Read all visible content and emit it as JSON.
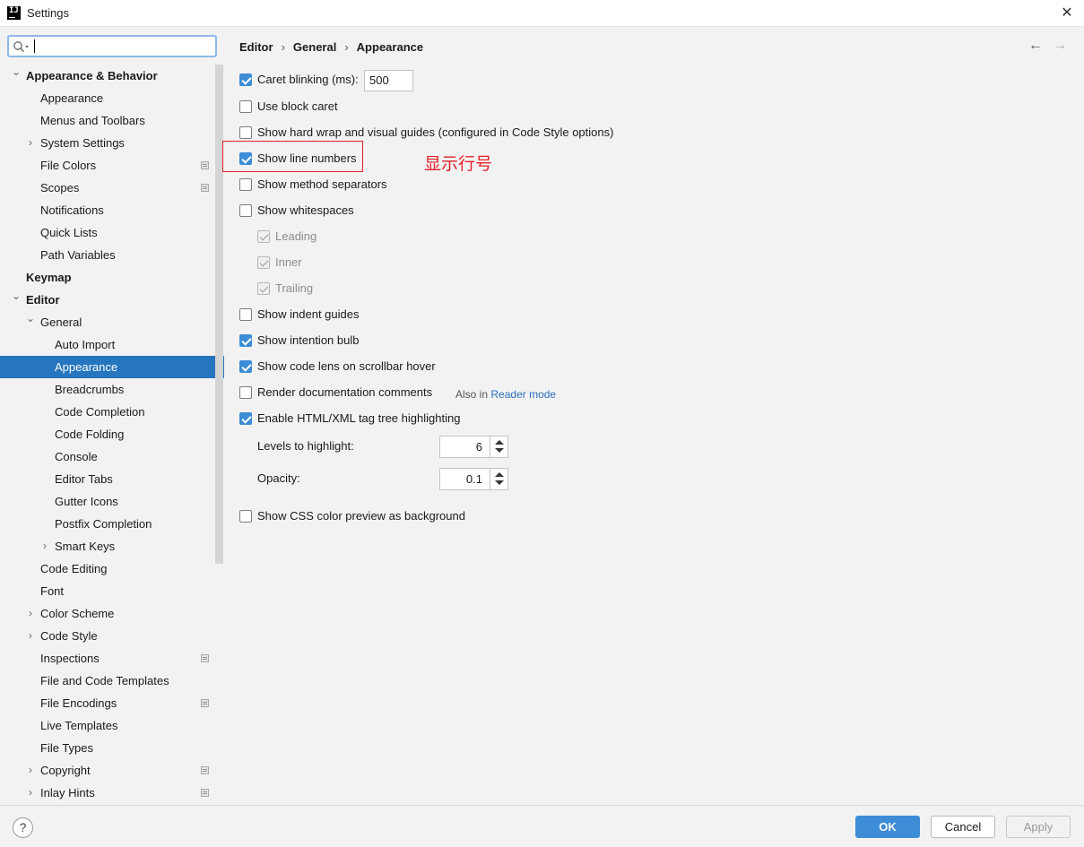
{
  "window": {
    "title": "Settings"
  },
  "sidebar": {
    "search_value": "",
    "items": [
      {
        "label": "Appearance & Behavior",
        "level": 0,
        "chev": "down",
        "bold": true,
        "proj": false
      },
      {
        "label": "Appearance",
        "level": 1,
        "chev": "",
        "bold": false,
        "proj": false
      },
      {
        "label": "Menus and Toolbars",
        "level": 1,
        "chev": "",
        "bold": false,
        "proj": false
      },
      {
        "label": "System Settings",
        "level": 1,
        "chev": "right",
        "bold": false,
        "proj": false
      },
      {
        "label": "File Colors",
        "level": 1,
        "chev": "",
        "bold": false,
        "proj": true
      },
      {
        "label": "Scopes",
        "level": 1,
        "chev": "",
        "bold": false,
        "proj": true
      },
      {
        "label": "Notifications",
        "level": 1,
        "chev": "",
        "bold": false,
        "proj": false
      },
      {
        "label": "Quick Lists",
        "level": 1,
        "chev": "",
        "bold": false,
        "proj": false
      },
      {
        "label": "Path Variables",
        "level": 1,
        "chev": "",
        "bold": false,
        "proj": false
      },
      {
        "label": "Keymap",
        "level": 0,
        "chev": "",
        "bold": true,
        "proj": false
      },
      {
        "label": "Editor",
        "level": 0,
        "chev": "down",
        "bold": true,
        "proj": false
      },
      {
        "label": "General",
        "level": 1,
        "chev": "down",
        "bold": false,
        "proj": false
      },
      {
        "label": "Auto Import",
        "level": 2,
        "chev": "",
        "bold": false,
        "proj": false
      },
      {
        "label": "Appearance",
        "level": 2,
        "chev": "",
        "bold": false,
        "proj": false,
        "selected": true
      },
      {
        "label": "Breadcrumbs",
        "level": 2,
        "chev": "",
        "bold": false,
        "proj": false
      },
      {
        "label": "Code Completion",
        "level": 2,
        "chev": "",
        "bold": false,
        "proj": false
      },
      {
        "label": "Code Folding",
        "level": 2,
        "chev": "",
        "bold": false,
        "proj": false
      },
      {
        "label": "Console",
        "level": 2,
        "chev": "",
        "bold": false,
        "proj": false
      },
      {
        "label": "Editor Tabs",
        "level": 2,
        "chev": "",
        "bold": false,
        "proj": false
      },
      {
        "label": "Gutter Icons",
        "level": 2,
        "chev": "",
        "bold": false,
        "proj": false
      },
      {
        "label": "Postfix Completion",
        "level": 2,
        "chev": "",
        "bold": false,
        "proj": false
      },
      {
        "label": "Smart Keys",
        "level": 2,
        "chev": "right",
        "bold": false,
        "proj": false
      },
      {
        "label": "Code Editing",
        "level": 1,
        "chev": "",
        "bold": false,
        "proj": false
      },
      {
        "label": "Font",
        "level": 1,
        "chev": "",
        "bold": false,
        "proj": false
      },
      {
        "label": "Color Scheme",
        "level": 1,
        "chev": "right",
        "bold": false,
        "proj": false
      },
      {
        "label": "Code Style",
        "level": 1,
        "chev": "right",
        "bold": false,
        "proj": false
      },
      {
        "label": "Inspections",
        "level": 1,
        "chev": "",
        "bold": false,
        "proj": true
      },
      {
        "label": "File and Code Templates",
        "level": 1,
        "chev": "",
        "bold": false,
        "proj": false
      },
      {
        "label": "File Encodings",
        "level": 1,
        "chev": "",
        "bold": false,
        "proj": true
      },
      {
        "label": "Live Templates",
        "level": 1,
        "chev": "",
        "bold": false,
        "proj": false
      },
      {
        "label": "File Types",
        "level": 1,
        "chev": "",
        "bold": false,
        "proj": false
      },
      {
        "label": "Copyright",
        "level": 1,
        "chev": "right",
        "bold": false,
        "proj": true
      },
      {
        "label": "Inlay Hints",
        "level": 1,
        "chev": "right",
        "bold": false,
        "proj": true
      }
    ]
  },
  "breadcrumb": {
    "part1": "Editor",
    "part2": "General",
    "part3": "Appearance",
    "sep": "›"
  },
  "options": {
    "caret_blinking": {
      "label": "Caret blinking (ms):",
      "checked": true,
      "value": "500"
    },
    "block_caret": {
      "label": "Use block caret",
      "checked": false
    },
    "hard_wrap": {
      "label": "Show hard wrap and visual guides (configured in Code Style options)",
      "checked": false
    },
    "line_numbers": {
      "label": "Show line numbers",
      "checked": true
    },
    "method_separators": {
      "label": "Show method separators",
      "checked": false
    },
    "whitespaces": {
      "label": "Show whitespaces",
      "checked": false
    },
    "leading": {
      "label": "Leading",
      "checked": true,
      "disabled": true
    },
    "inner": {
      "label": "Inner",
      "checked": true,
      "disabled": true
    },
    "trailing": {
      "label": "Trailing",
      "checked": true,
      "disabled": true
    },
    "indent_guides": {
      "label": "Show indent guides",
      "checked": false
    },
    "intention_bulb": {
      "label": "Show intention bulb",
      "checked": true
    },
    "code_lens": {
      "label": "Show code lens on scrollbar hover",
      "checked": true
    },
    "render_docs": {
      "label": "Render documentation comments",
      "checked": false,
      "also_in": "Also in",
      "reader_mode": "Reader mode"
    },
    "tag_tree": {
      "label": "Enable HTML/XML tag tree highlighting",
      "checked": true
    },
    "levels": {
      "label": "Levels to highlight:",
      "value": "6"
    },
    "opacity": {
      "label": "Opacity:",
      "value": "0.1"
    },
    "css_preview": {
      "label": "Show CSS color preview as background",
      "checked": false
    }
  },
  "annotation": {
    "text": "显示行号",
    "color": "#e3202a"
  },
  "buttons": {
    "ok": "OK",
    "cancel": "Cancel",
    "apply": "Apply",
    "help": "?"
  },
  "colors": {
    "accent": "#2675bf",
    "checkbox": "#3d8cd6",
    "link": "#2b6fbd"
  }
}
